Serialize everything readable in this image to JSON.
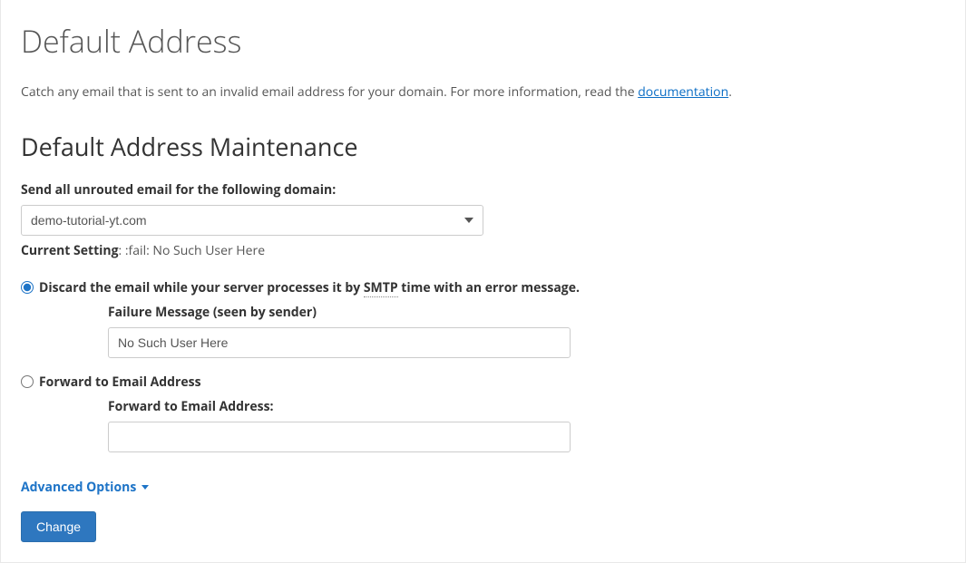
{
  "header": {
    "title": "Default Address",
    "description_prefix": "Catch any email that is sent to an invalid email address for your domain. For more information, read the ",
    "doc_link_text": "documentation",
    "description_suffix": "."
  },
  "section": {
    "heading": "Default Address Maintenance",
    "domain_label": "Send all unrouted email for the following domain:",
    "domain_selected": "demo-tutorial-yt.com",
    "current_setting_label": "Current Setting",
    "current_setting_value": ": :fail: No Such User Here"
  },
  "options": {
    "discard": {
      "label_pre": "Discard the email while your server processes it by ",
      "smtp": "SMTP",
      "label_post": " time with an error message.",
      "failure_label": "Failure Message (seen by sender)",
      "failure_value": "No Such User Here"
    },
    "forward": {
      "label": "Forward to Email Address",
      "field_label": "Forward to Email Address:",
      "field_value": ""
    }
  },
  "advanced": {
    "toggle_label": "Advanced Options"
  },
  "actions": {
    "change_label": "Change"
  }
}
